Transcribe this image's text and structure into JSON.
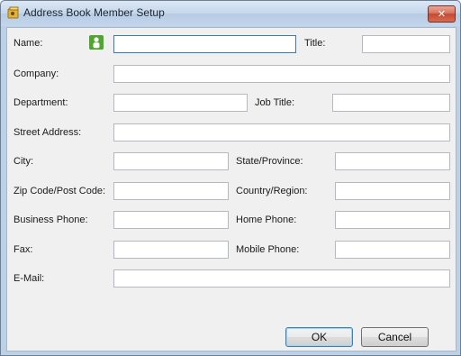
{
  "window": {
    "title": "Address Book Member Setup",
    "close_glyph": "✕"
  },
  "labels": {
    "name": "Name:",
    "title": "Title:",
    "company": "Company:",
    "department": "Department:",
    "job_title": "Job Title:",
    "street_address": "Street Address:",
    "city": "City:",
    "state_province": "State/Province:",
    "zip_post_code": "Zip Code/Post Code:",
    "country_region": "Country/Region:",
    "business_phone": "Business Phone:",
    "home_phone": "Home Phone:",
    "fax": "Fax:",
    "mobile_phone": "Mobile Phone:",
    "email": "E-Mail:"
  },
  "values": {
    "name": "",
    "title": "",
    "company": "",
    "department": "",
    "job_title": "",
    "street_address": "",
    "city": "",
    "state_province": "",
    "zip_post_code": "",
    "country_region": "",
    "business_phone": "",
    "home_phone": "",
    "fax": "",
    "mobile_phone": "",
    "email": ""
  },
  "buttons": {
    "ok": "OK",
    "cancel": "Cancel"
  },
  "icons": {
    "app": "address-book-icon",
    "name_picker": "person-icon"
  },
  "colors": {
    "person_icon": "#4fa62f",
    "close_button": "#c44a33"
  }
}
